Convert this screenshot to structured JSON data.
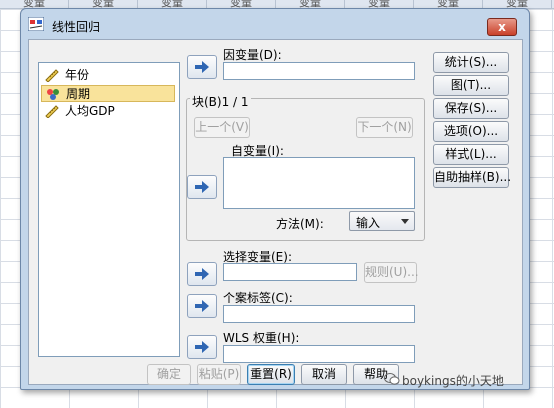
{
  "background": {
    "column_header_label": "变量",
    "column_headers": [
      "变量",
      "变量",
      "变量",
      "变量",
      "变量",
      "变量",
      "变量",
      "变量"
    ]
  },
  "dialog": {
    "title": "线性回归",
    "close_glyph": "x"
  },
  "variables": [
    {
      "label": "年份",
      "icon": "ruler-icon",
      "selected": false
    },
    {
      "label": "周期",
      "icon": "nominal-people-icon",
      "selected": true
    },
    {
      "label": "人均GDP",
      "icon": "ruler-icon",
      "selected": false
    }
  ],
  "dependent": {
    "label": "因变量(D):",
    "value": ""
  },
  "block": {
    "label": "块(B)1 / 1",
    "prev_label": "上一个(V)",
    "next_label": "下一个(N)",
    "independent_label": "自变量(I):",
    "method_label": "方法(M):",
    "method_value": "输入"
  },
  "selection": {
    "label": "选择变量(E):",
    "rule_label": "规则(U)..."
  },
  "case_label": {
    "label": "个案标签(C):"
  },
  "wls": {
    "label": "WLS 权重(H):"
  },
  "side_buttons": [
    "统计(S)...",
    "图(T)...",
    "保存(S)...",
    "选项(O)...",
    "样式(L)...",
    "自助抽样(B)..."
  ],
  "bottom_buttons": {
    "ok": "确定",
    "paste": "粘贴(P)",
    "reset": "重置(R)",
    "cancel": "取消",
    "help": "帮助"
  },
  "watermark": "boykings的小天地",
  "colors": {
    "selected_bg": "#f9e39b",
    "arrow": "#2f66b3",
    "dialog_frame": "#c3d6ea"
  }
}
